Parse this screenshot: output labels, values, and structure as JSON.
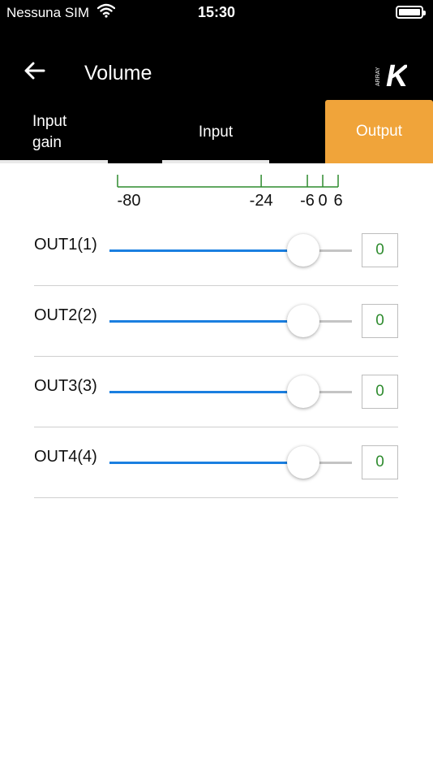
{
  "status_bar": {
    "carrier": "Nessuna SIM",
    "time": "15:30",
    "wifi_icon": "wifi-icon",
    "battery_icon": "battery-icon"
  },
  "app_bar": {
    "title": "Volume",
    "back_icon": "arrow-left-icon",
    "logo_letter": "K",
    "logo_text": "ARRAY"
  },
  "tabs": [
    {
      "label": "Input gain",
      "line1": "Input",
      "line2": "gain",
      "active": false
    },
    {
      "label": "Input",
      "active": false
    },
    {
      "label": "Output",
      "active": true
    }
  ],
  "colors": {
    "accent": "#f0a43a",
    "slider_active": "#1a7fe0",
    "slider_inactive": "#c4c4c4",
    "scale_line": "#2e8b2e",
    "value_text": "#2e8b2e"
  },
  "scale": {
    "min": -80,
    "max": 6,
    "ticks": [
      {
        "label": "-80",
        "value": -80
      },
      {
        "label": "-24",
        "value": -24
      },
      {
        "label": "-6",
        "value": -6
      },
      {
        "label": "0",
        "value": 0
      },
      {
        "label": "6",
        "value": 6
      }
    ]
  },
  "channels": [
    {
      "label": "OUT1(1)",
      "value": "0",
      "level_db": 0
    },
    {
      "label": "OUT2(2)",
      "value": "0",
      "level_db": 0
    },
    {
      "label": "OUT3(3)",
      "value": "0",
      "level_db": 0
    },
    {
      "label": "OUT4(4)",
      "value": "0",
      "level_db": 0
    }
  ]
}
